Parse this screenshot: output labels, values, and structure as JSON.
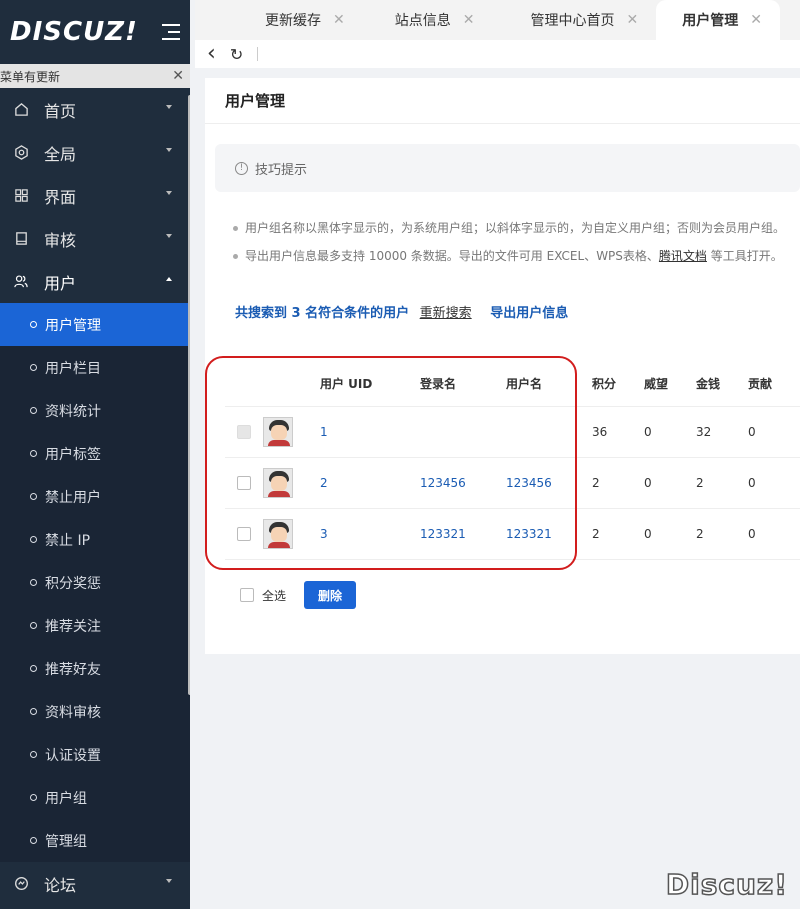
{
  "brand": {
    "logo_text": "DISCUZ!"
  },
  "notice": {
    "text": "菜单有更新",
    "close": "✕"
  },
  "sidebar": {
    "top_items": [
      {
        "label": "首页",
        "icon": "home-icon"
      },
      {
        "label": "全局",
        "icon": "settings-icon"
      },
      {
        "label": "界面",
        "icon": "layout-icon"
      },
      {
        "label": "审核",
        "icon": "book-icon"
      },
      {
        "label": "用户",
        "icon": "users-icon",
        "open": true
      }
    ],
    "user_sub_items": [
      {
        "label": "用户管理",
        "active": true
      },
      {
        "label": "用户栏目"
      },
      {
        "label": "资料统计"
      },
      {
        "label": "用户标签"
      },
      {
        "label": "禁止用户"
      },
      {
        "label": "禁止 IP"
      },
      {
        "label": "积分奖惩"
      },
      {
        "label": "推荐关注"
      },
      {
        "label": "推荐好友"
      },
      {
        "label": "资料审核"
      },
      {
        "label": "认证设置"
      },
      {
        "label": "用户组"
      },
      {
        "label": "管理组"
      }
    ],
    "bottom_item": {
      "label": "论坛",
      "icon": "forum-icon"
    }
  },
  "tabs": [
    {
      "label": "更新缓存"
    },
    {
      "label": "站点信息"
    },
    {
      "label": "管理中心首页"
    },
    {
      "label": "用户管理",
      "active": true
    }
  ],
  "tab_close": "✕",
  "toolbar": {
    "back": "‹",
    "refresh": "↻"
  },
  "page": {
    "title": "用户管理"
  },
  "tip": {
    "title": "技巧提示"
  },
  "tips": {
    "line1": "用户组名称以黑体字显示的，为系统用户组；以斜体字显示的，为自定义用户组；否则为会员用户组。",
    "line2_prefix": "导出用户信息最多支持 10000 条数据。导出的文件可用 EXCEL、WPS表格、",
    "line2_link": "腾讯文档",
    "line2_suffix": " 等工具打开。"
  },
  "summary": {
    "text": "共搜索到 3 名符合条件的用户",
    "research": "重新搜索",
    "export": "导出用户信息"
  },
  "table": {
    "headers": {
      "uid": "用户 UID",
      "login": "登录名",
      "name": "用户名",
      "score": "积分",
      "prestige": "威望",
      "money": "金钱",
      "contrib": "贡献"
    },
    "rows": [
      {
        "uid": "1",
        "login": "",
        "name": "",
        "score": "36",
        "prestige": "0",
        "money": "32",
        "contrib": "0",
        "disabled": true
      },
      {
        "uid": "2",
        "login": "123456",
        "name": "123456",
        "score": "2",
        "prestige": "0",
        "money": "2",
        "contrib": "0"
      },
      {
        "uid": "3",
        "login": "123321",
        "name": "123321",
        "score": "2",
        "prestige": "0",
        "money": "2",
        "contrib": "0"
      }
    ]
  },
  "footer": {
    "select_all": "全选",
    "delete": "删除"
  },
  "watermark": {
    "text": "Discuz!"
  }
}
